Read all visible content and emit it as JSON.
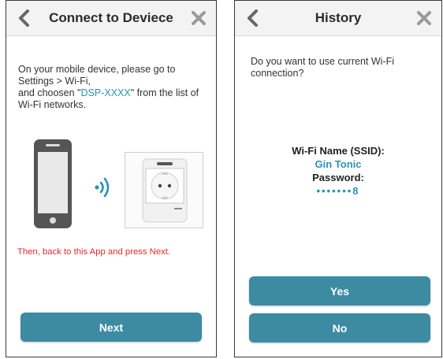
{
  "colors": {
    "accent": "#2a93b4",
    "button": "#3d8aa3",
    "warning": "#e02a2a",
    "header_bg": "#f3f3f3"
  },
  "left_screen": {
    "header": {
      "title": "Connect to Deviece",
      "back_icon": "chevron-left-icon",
      "close_icon": "x-icon"
    },
    "instructions": {
      "line1": "On your mobile device, please go to Settings > Wi-Fi,",
      "line2_prefix": "and choosen \"",
      "ssid": "DSP-XXXX",
      "line2_suffix": "\" from the list of Wi-Fi networks."
    },
    "illustration": {
      "phone_icon": "smartphone-icon",
      "signal_icon": "wifi-signal-icon",
      "device_icon": "smart-plug-icon"
    },
    "note": "Then, back to this App and press Next.",
    "next_button": "Next"
  },
  "right_screen": {
    "header": {
      "title": "History",
      "back_icon": "chevron-left-icon",
      "close_icon": "x-icon"
    },
    "question": "Do you want to use current Wi-Fi connection?",
    "wifi": {
      "name_label": "Wi-Fi Name (SSID):",
      "name_value": "Gin Tonic",
      "password_label": "Password:",
      "password_value": "•••••••8"
    },
    "yes_button": "Yes",
    "no_button": "No"
  }
}
